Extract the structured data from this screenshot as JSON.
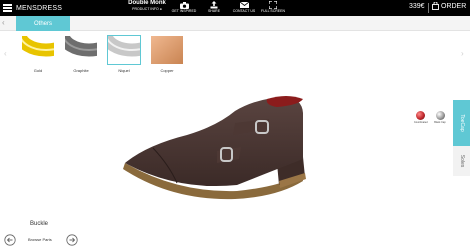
{
  "header": {
    "brand": "MENSDRESS",
    "product_name": "Double Monk",
    "product_info": "PRODUCT INFO",
    "tools": [
      {
        "label": "GET INSPIRED",
        "icon": "camera-icon"
      },
      {
        "label": "SHARE",
        "icon": "share-icon"
      },
      {
        "label": "CONTACT US",
        "icon": "mail-icon"
      },
      {
        "label": "FULL SCREEN",
        "icon": "fullscreen-icon"
      }
    ],
    "price": "339€",
    "order_label": "ORDER"
  },
  "subnav": {
    "active_tab": "Others"
  },
  "materials": [
    {
      "label": "Gold",
      "color": "#e8c400"
    },
    {
      "label": "Graphite",
      "color": "#6e6e6e"
    },
    {
      "label": "Niquel",
      "color": "#c8c8c8",
      "selected": true
    },
    {
      "label": "Copper",
      "color": "#d99a6c"
    }
  ],
  "side_tabs": {
    "toecap": "ToeCap",
    "soles": "Soles"
  },
  "color_options": [
    {
      "label": "Coordinated",
      "color": "#c0282d"
    },
    {
      "label": "Black Cap",
      "color": "#7a7a7a"
    }
  ],
  "component_label": "Buckle",
  "footer": {
    "browse_label": "Browse Parts"
  },
  "colors": {
    "accent": "#5fc8d4",
    "topbar": "#000000"
  }
}
